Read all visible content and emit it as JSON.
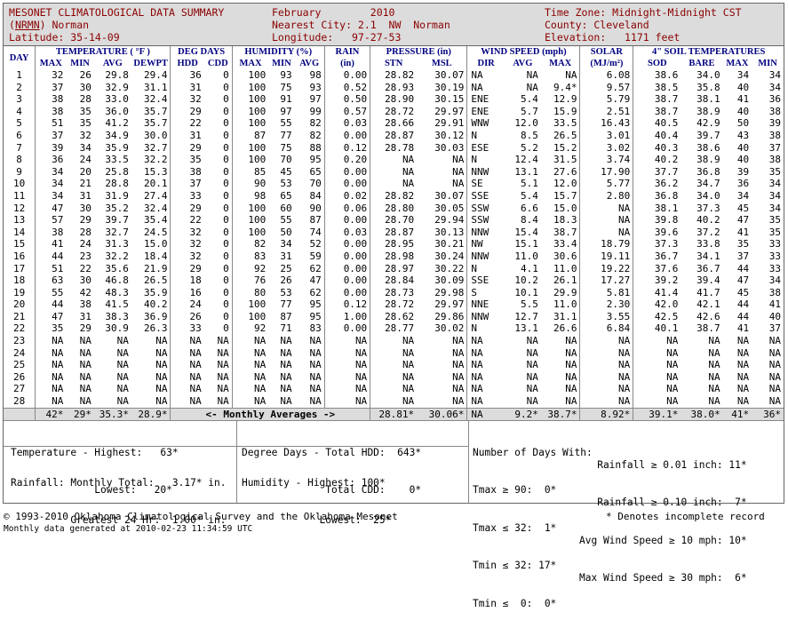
{
  "header": {
    "title": "MESONET CLIMATOLOGICAL DATA SUMMARY",
    "station_code": "NRMN",
    "station_name": "Norman",
    "latitude": "Latitude: 35-14-09",
    "month": "February",
    "year": "2010",
    "nearest_city": "Nearest City: 2.1  NW  Norman",
    "longitude": "Longitude:   97-27-53",
    "time_zone": "Time Zone: Midnight-Midnight CST",
    "county": "County: Cleveland",
    "elevation": "Elevation:   1171 feet"
  },
  "columns": {
    "day": "DAY",
    "temperature": "TEMPERATURE ( °F )",
    "temp_sub": [
      "MAX",
      "MIN",
      "AVG",
      "DEWPT"
    ],
    "degdays": "DEG DAYS",
    "degdays_sub": [
      "HDD",
      "CDD"
    ],
    "humidity": "HUMIDITY (%)",
    "humidity_sub": [
      "MAX",
      "MIN",
      "AVG"
    ],
    "rain": "RAIN",
    "rain_sub": "(in)",
    "pressure": "PRESSURE (in)",
    "pressure_sub": [
      "STN",
      "MSL"
    ],
    "wind": "WIND SPEED (mph)",
    "wind_sub": [
      "DIR",
      "AVG",
      "MAX"
    ],
    "solar": "SOLAR",
    "solar_sub": "(MJ/m²)",
    "soil": "4\" SOIL TEMPERATURES",
    "soil_sub": [
      "SOD",
      "BARE",
      "MAX",
      "MIN"
    ]
  },
  "rows": [
    [
      "1",
      "32",
      "26",
      "29.8",
      "29.4",
      "36",
      "0",
      "100",
      "93",
      "98",
      "0.00",
      "28.82",
      "30.07",
      "NA",
      "NA",
      "NA",
      "6.08",
      "38.6",
      "34.0",
      "34",
      "34"
    ],
    [
      "2",
      "37",
      "30",
      "32.9",
      "31.1",
      "31",
      "0",
      "100",
      "75",
      "93",
      "0.52",
      "28.93",
      "30.19",
      "NA",
      "NA",
      "9.4*",
      "9.57",
      "38.5",
      "35.8",
      "40",
      "34"
    ],
    [
      "3",
      "38",
      "28",
      "33.0",
      "32.4",
      "32",
      "0",
      "100",
      "91",
      "97",
      "0.50",
      "28.90",
      "30.15",
      "ENE",
      "5.4",
      "12.9",
      "5.79",
      "38.7",
      "38.1",
      "41",
      "36"
    ],
    [
      "4",
      "38",
      "35",
      "36.0",
      "35.7",
      "29",
      "0",
      "100",
      "97",
      "99",
      "0.57",
      "28.72",
      "29.97",
      "ENE",
      "5.7",
      "15.9",
      "2.51",
      "38.7",
      "38.9",
      "40",
      "38"
    ],
    [
      "5",
      "51",
      "35",
      "41.2",
      "35.7",
      "22",
      "0",
      "100",
      "55",
      "82",
      "0.03",
      "28.66",
      "29.91",
      "WNW",
      "12.0",
      "33.5",
      "16.43",
      "40.5",
      "42.9",
      "50",
      "39"
    ],
    [
      "6",
      "37",
      "32",
      "34.9",
      "30.0",
      "31",
      "0",
      "87",
      "77",
      "82",
      "0.00",
      "28.87",
      "30.12",
      "N",
      "8.5",
      "26.5",
      "3.01",
      "40.4",
      "39.7",
      "43",
      "38"
    ],
    [
      "7",
      "39",
      "34",
      "35.9",
      "32.7",
      "29",
      "0",
      "100",
      "75",
      "88",
      "0.12",
      "28.78",
      "30.03",
      "ESE",
      "5.2",
      "15.2",
      "3.02",
      "40.3",
      "38.6",
      "40",
      "37"
    ],
    [
      "8",
      "36",
      "24",
      "33.5",
      "32.2",
      "35",
      "0",
      "100",
      "70",
      "95",
      "0.20",
      "NA",
      "NA",
      "N",
      "12.4",
      "31.5",
      "3.74",
      "40.2",
      "38.9",
      "40",
      "38"
    ],
    [
      "9",
      "34",
      "20",
      "25.8",
      "15.3",
      "38",
      "0",
      "85",
      "45",
      "65",
      "0.00",
      "NA",
      "NA",
      "NNW",
      "13.1",
      "27.6",
      "17.90",
      "37.7",
      "36.8",
      "39",
      "35"
    ],
    [
      "10",
      "34",
      "21",
      "28.8",
      "20.1",
      "37",
      "0",
      "90",
      "53",
      "70",
      "0.00",
      "NA",
      "NA",
      "SE",
      "5.1",
      "12.0",
      "5.77",
      "36.2",
      "34.7",
      "36",
      "34"
    ],
    [
      "11",
      "34",
      "31",
      "31.9",
      "27.4",
      "33",
      "0",
      "98",
      "65",
      "84",
      "0.02",
      "28.82",
      "30.07",
      "SSE",
      "5.4",
      "15.7",
      "2.80",
      "36.8",
      "34.0",
      "34",
      "34"
    ],
    [
      "12",
      "47",
      "30",
      "35.2",
      "32.4",
      "29",
      "0",
      "100",
      "60",
      "90",
      "0.06",
      "28.80",
      "30.05",
      "SSW",
      "6.6",
      "15.0",
      "NA",
      "38.1",
      "37.3",
      "45",
      "34"
    ],
    [
      "13",
      "57",
      "29",
      "39.7",
      "35.4",
      "22",
      "0",
      "100",
      "55",
      "87",
      "0.00",
      "28.70",
      "29.94",
      "SSW",
      "8.4",
      "18.3",
      "NA",
      "39.8",
      "40.2",
      "47",
      "35"
    ],
    [
      "14",
      "38",
      "28",
      "32.7",
      "24.5",
      "32",
      "0",
      "100",
      "50",
      "74",
      "0.03",
      "28.87",
      "30.13",
      "NNW",
      "15.4",
      "38.7",
      "NA",
      "39.6",
      "37.2",
      "41",
      "35"
    ],
    [
      "15",
      "41",
      "24",
      "31.3",
      "15.0",
      "32",
      "0",
      "82",
      "34",
      "52",
      "0.00",
      "28.95",
      "30.21",
      "NW",
      "15.1",
      "33.4",
      "18.79",
      "37.3",
      "33.8",
      "35",
      "33"
    ],
    [
      "16",
      "44",
      "23",
      "32.2",
      "18.4",
      "32",
      "0",
      "83",
      "31",
      "59",
      "0.00",
      "28.98",
      "30.24",
      "NNW",
      "11.0",
      "30.6",
      "19.11",
      "36.7",
      "34.1",
      "37",
      "33"
    ],
    [
      "17",
      "51",
      "22",
      "35.6",
      "21.9",
      "29",
      "0",
      "92",
      "25",
      "62",
      "0.00",
      "28.97",
      "30.22",
      "N",
      "4.1",
      "11.0",
      "19.22",
      "37.6",
      "36.7",
      "44",
      "33"
    ],
    [
      "18",
      "63",
      "30",
      "46.8",
      "26.5",
      "18",
      "0",
      "76",
      "26",
      "47",
      "0.00",
      "28.84",
      "30.09",
      "SSE",
      "10.2",
      "26.1",
      "17.27",
      "39.2",
      "39.4",
      "47",
      "34"
    ],
    [
      "19",
      "55",
      "42",
      "48.3",
      "35.9",
      "16",
      "0",
      "80",
      "53",
      "62",
      "0.00",
      "28.73",
      "29.98",
      "S",
      "10.1",
      "29.9",
      "5.81",
      "41.4",
      "41.7",
      "45",
      "38"
    ],
    [
      "20",
      "44",
      "38",
      "41.5",
      "40.2",
      "24",
      "0",
      "100",
      "77",
      "95",
      "0.12",
      "28.72",
      "29.97",
      "NNE",
      "5.5",
      "11.0",
      "2.30",
      "42.0",
      "42.1",
      "44",
      "41"
    ],
    [
      "21",
      "47",
      "31",
      "38.3",
      "36.9",
      "26",
      "0",
      "100",
      "87",
      "95",
      "1.00",
      "28.62",
      "29.86",
      "NNW",
      "12.7",
      "31.1",
      "3.55",
      "42.5",
      "42.6",
      "44",
      "40"
    ],
    [
      "22",
      "35",
      "29",
      "30.9",
      "26.3",
      "33",
      "0",
      "92",
      "71",
      "83",
      "0.00",
      "28.77",
      "30.02",
      "N",
      "13.1",
      "26.6",
      "6.84",
      "40.1",
      "38.7",
      "41",
      "37"
    ],
    [
      "23",
      "NA",
      "NA",
      "NA",
      "NA",
      "NA",
      "NA",
      "NA",
      "NA",
      "NA",
      "NA",
      "NA",
      "NA",
      "NA",
      "NA",
      "NA",
      "NA",
      "NA",
      "NA",
      "NA",
      "NA"
    ],
    [
      "24",
      "NA",
      "NA",
      "NA",
      "NA",
      "NA",
      "NA",
      "NA",
      "NA",
      "NA",
      "NA",
      "NA",
      "NA",
      "NA",
      "NA",
      "NA",
      "NA",
      "NA",
      "NA",
      "NA",
      "NA"
    ],
    [
      "25",
      "NA",
      "NA",
      "NA",
      "NA",
      "NA",
      "NA",
      "NA",
      "NA",
      "NA",
      "NA",
      "NA",
      "NA",
      "NA",
      "NA",
      "NA",
      "NA",
      "NA",
      "NA",
      "NA",
      "NA"
    ],
    [
      "26",
      "NA",
      "NA",
      "NA",
      "NA",
      "NA",
      "NA",
      "NA",
      "NA",
      "NA",
      "NA",
      "NA",
      "NA",
      "NA",
      "NA",
      "NA",
      "NA",
      "NA",
      "NA",
      "NA",
      "NA"
    ],
    [
      "27",
      "NA",
      "NA",
      "NA",
      "NA",
      "NA",
      "NA",
      "NA",
      "NA",
      "NA",
      "NA",
      "NA",
      "NA",
      "NA",
      "NA",
      "NA",
      "NA",
      "NA",
      "NA",
      "NA",
      "NA"
    ],
    [
      "28",
      "NA",
      "NA",
      "NA",
      "NA",
      "NA",
      "NA",
      "NA",
      "NA",
      "NA",
      "NA",
      "NA",
      "NA",
      "NA",
      "NA",
      "NA",
      "NA",
      "NA",
      "NA",
      "NA",
      "NA"
    ]
  ],
  "averages": {
    "temp": [
      "42*",
      "29*",
      "35.3*",
      "28.9*"
    ],
    "label": "<- Monthly Averages ->",
    "pressure": [
      "28.81*",
      "30.06*"
    ],
    "wind": [
      "NA",
      "9.2*",
      "38.7*"
    ],
    "solar": "8.92*",
    "soil": [
      "39.1*",
      "38.0*",
      "41*",
      "36*"
    ]
  },
  "summary": {
    "temp_highest": "Temperature - Highest:   63*",
    "temp_lowest": "              Lowest:   20*",
    "rain_total": "Rainfall: Monthly Total:   3.17* in.",
    "rain_24hr": "          Greatest 24 Hr:  1.00* in.",
    "hdd": "Degree Days - Total HDD:  643*",
    "cdd": "              Total CDD:    0*",
    "hum_high": "Humidity - Highest: 100*",
    "hum_low": "             Lowest:  25*",
    "days_title": "Number of Days With:",
    "d1": "Tmax ≥ 90:  0*",
    "d2": "Tmax ≤ 32:  1*",
    "d3": "Tmin ≤ 32: 17*",
    "d4": "Tmin ≤  0:  0*",
    "r1": "Rainfall ≥ 0.01 inch: 11*",
    "r2": "Rainfall ≥ 0.10 inch:  7*",
    "r3": "Avg Wind Speed ≥ 10 mph: 10*",
    "r4": "Max Wind Speed ≥ 30 mph:  6*"
  },
  "footer": {
    "copyright": "© 1993-2010 Oklahoma Climatological Survey and the Oklahoma Mesonet",
    "generated": "Monthly data generated at 2010-02-23 11:34:59 UTC",
    "note": "* Denotes incomplete record"
  }
}
